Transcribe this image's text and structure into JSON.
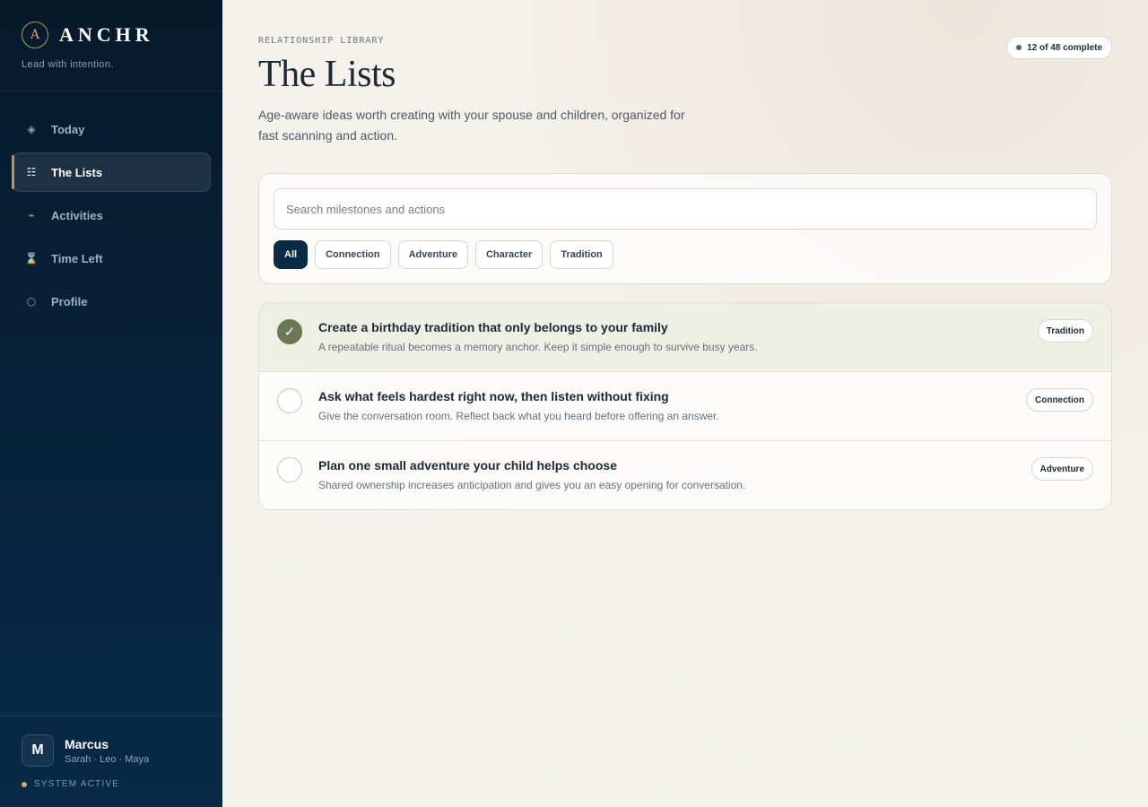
{
  "brand": {
    "mark": "A",
    "name": "ANCHR",
    "tagline": "Lead with intention."
  },
  "nav": {
    "items": [
      {
        "icon": "◈",
        "label": "Today"
      },
      {
        "icon": "☷",
        "label": "The Lists"
      },
      {
        "icon": "⌁",
        "label": "Activities"
      },
      {
        "icon": "⌛",
        "label": "Time Left"
      },
      {
        "icon": "○",
        "label": "Profile"
      }
    ],
    "active": "The Lists"
  },
  "user": {
    "initial": "M",
    "name": "Marcus",
    "family": "Sarah · Leo · Maya",
    "status": "SYSTEM ACTIVE"
  },
  "header": {
    "eyebrow": "RELATIONSHIP LIBRARY",
    "title": "The Lists",
    "description": "Age-aware ideas worth creating with your spouse and children, organized for fast scanning and action.",
    "progress": "12 of 48 complete"
  },
  "search": {
    "placeholder": "Search milestones and actions",
    "value": ""
  },
  "filters": {
    "chips": [
      "All",
      "Connection",
      "Adventure",
      "Character",
      "Tradition"
    ],
    "selected": "All"
  },
  "items": [
    {
      "title": "Create a birthday tradition that only belongs to your family",
      "description": "A repeatable ritual becomes a memory anchor. Keep it simple enough to survive busy years.",
      "tag": "Tradition",
      "done": true,
      "check_glyph": "✓"
    },
    {
      "title": "Ask what feels hardest right now, then listen without fixing",
      "description": "Give the conversation room. Reflect back what you heard before offering an answer.",
      "tag": "Connection",
      "done": false,
      "check_glyph": ""
    },
    {
      "title": "Plan one small adventure your child helps choose",
      "description": "Shared ownership increases anticipation and gives you an easy opening for conversation.",
      "tag": "Adventure",
      "done": false,
      "check_glyph": ""
    }
  ],
  "colors": {
    "sidebar": "#061a2b",
    "accent_gold": "#b69a5c",
    "chip_active": "#0b2a47",
    "check_done": "#6b7855"
  }
}
